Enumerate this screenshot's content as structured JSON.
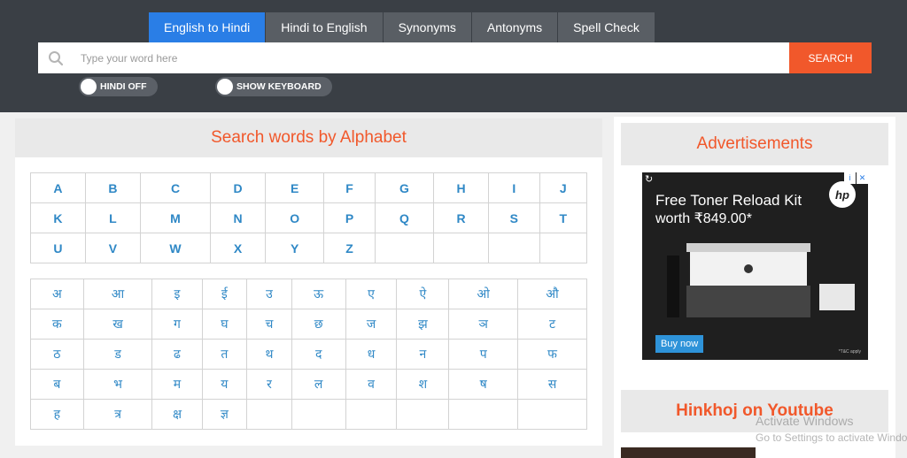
{
  "tabs": [
    {
      "label": "English to Hindi",
      "active": true
    },
    {
      "label": "Hindi to English",
      "active": false
    },
    {
      "label": "Synonyms",
      "active": false
    },
    {
      "label": "Antonyms",
      "active": false
    },
    {
      "label": "Spell Check",
      "active": false
    }
  ],
  "search": {
    "placeholder": "Type your word here",
    "value": "",
    "button_label": "SEARCH"
  },
  "toggles": {
    "hindi": "HINDI OFF",
    "keyboard": "SHOW KEYBOARD"
  },
  "alphabet_panel": {
    "title": "Search words by Alphabet",
    "english_rows": [
      [
        "A",
        "B",
        "C",
        "D",
        "E",
        "F",
        "G",
        "H",
        "I",
        "J"
      ],
      [
        "K",
        "L",
        "M",
        "N",
        "O",
        "P",
        "Q",
        "R",
        "S",
        "T"
      ],
      [
        "U",
        "V",
        "W",
        "X",
        "Y",
        "Z",
        "",
        "",
        "",
        ""
      ]
    ],
    "hindi_rows": [
      [
        "अ",
        "आ",
        "इ",
        "ई",
        "उ",
        "ऊ",
        "ए",
        "ऐ",
        "ओ",
        "औ"
      ],
      [
        "क",
        "ख",
        "ग",
        "घ",
        "च",
        "छ",
        "ज",
        "झ",
        "ञ",
        "ट"
      ],
      [
        "ठ",
        "ड",
        "ढ",
        "त",
        "थ",
        "द",
        "ध",
        "न",
        "प",
        "फ"
      ],
      [
        "ब",
        "भ",
        "म",
        "य",
        "र",
        "ल",
        "व",
        "श",
        "ष",
        "स"
      ],
      [
        "ह",
        "त्र",
        "क्ष",
        "ज्ञ",
        "",
        "",
        "",
        "",
        "",
        ""
      ]
    ]
  },
  "advertisements": {
    "title": "Advertisements",
    "headline": "Free Toner Reload Kit",
    "price_line": "worth ₹849.00*",
    "cta": "Buy now",
    "brand": "hp",
    "fine_print": "*T&C apply"
  },
  "youtube": {
    "title": "Hinkhoj on Youtube"
  },
  "watermark": {
    "line1": "Activate Windows",
    "line2": "Go to Settings to activate Windows."
  },
  "colors": {
    "accent": "#f1582b",
    "active_tab": "#2a7ee6",
    "header_bg": "#3a3f45",
    "letter_link": "#2f88c6"
  }
}
